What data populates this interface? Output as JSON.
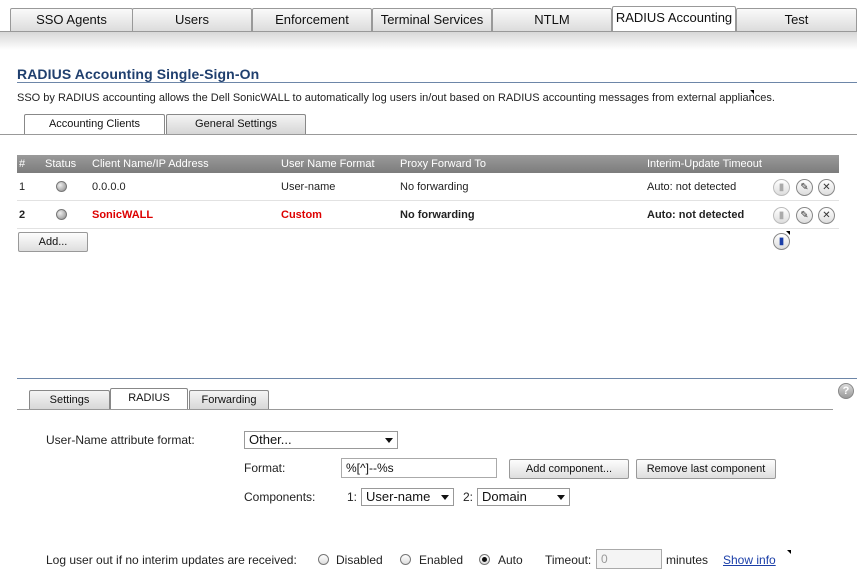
{
  "top_tabs": [
    "SSO Agents",
    "Users",
    "Enforcement",
    "Terminal Services",
    "NTLM",
    "RADIUS Accounting",
    "Test"
  ],
  "page_title": "RADIUS Accounting Single-Sign-On",
  "description": "SSO by RADIUS accounting allows the Dell SonicWALL to automatically log users in/out based on RADIUS accounting messages from external appliances.",
  "sub_tabs": [
    "Accounting Clients",
    "General Settings"
  ],
  "table": {
    "headers": [
      "#",
      "Status",
      "Client Name/IP Address",
      "User Name Format",
      "Proxy Forward To",
      "Interim-Update Timeout"
    ],
    "rows": [
      {
        "num": "1",
        "client": "0.0.0.0",
        "format": "User-name",
        "proxy": "No forwarding",
        "timeout": "Auto: not detected"
      },
      {
        "num": "2",
        "client": "SonicWALL",
        "format": "Custom",
        "proxy": "No forwarding",
        "timeout": "Auto: not detected"
      }
    ]
  },
  "add_button": "Add...",
  "edit_tabs": [
    "Settings",
    "RADIUS",
    "Forwarding"
  ],
  "form": {
    "username_format_label": "User-Name attribute format:",
    "username_format_value": "Other...",
    "format_label": "Format:",
    "format_value": "%[^]--%s",
    "add_component_button": "Add component...",
    "remove_component_button": "Remove last component",
    "components_label": "Components:",
    "component1_index": "1:",
    "component1_value": "User-name",
    "component2_index": "2:",
    "component2_value": "Domain",
    "logout_label": "Log user out if no interim updates are received:",
    "radio_disabled": "Disabled",
    "radio_enabled": "Enabled",
    "radio_auto": "Auto",
    "timeout_label": "Timeout:",
    "timeout_value": "0",
    "minutes_label": "minutes",
    "show_info_link": "Show info"
  },
  "help_icon": "?",
  "colors": {
    "title": "#1f3f6e",
    "highlight_red": "#dd0000",
    "link": "#1a3ea8"
  }
}
